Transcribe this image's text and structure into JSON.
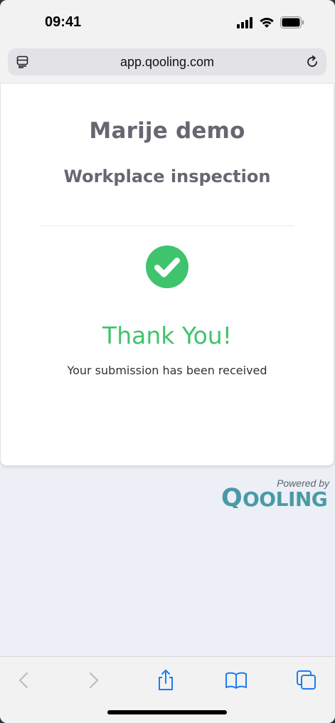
{
  "status_bar": {
    "time": "09:41"
  },
  "browser": {
    "url": "app.qooling.com"
  },
  "card": {
    "title": "Marije demo",
    "subtitle": "Workplace inspection",
    "thank_you": "Thank You!",
    "message": "Your submission has been received"
  },
  "branding": {
    "powered_by": "Powered by",
    "logo_text": "QOOLING"
  },
  "colors": {
    "success": "#3fc46d",
    "brand": "#4a9aa5",
    "link_blue": "#1a7df0"
  },
  "icons": {
    "reader": "reader-mode-icon",
    "reload": "reload-icon",
    "check": "check-circle-icon",
    "back": "back-chevron-icon",
    "forward": "forward-chevron-icon",
    "share": "share-icon",
    "bookmarks": "bookmarks-icon",
    "tabs": "tabs-icon"
  }
}
